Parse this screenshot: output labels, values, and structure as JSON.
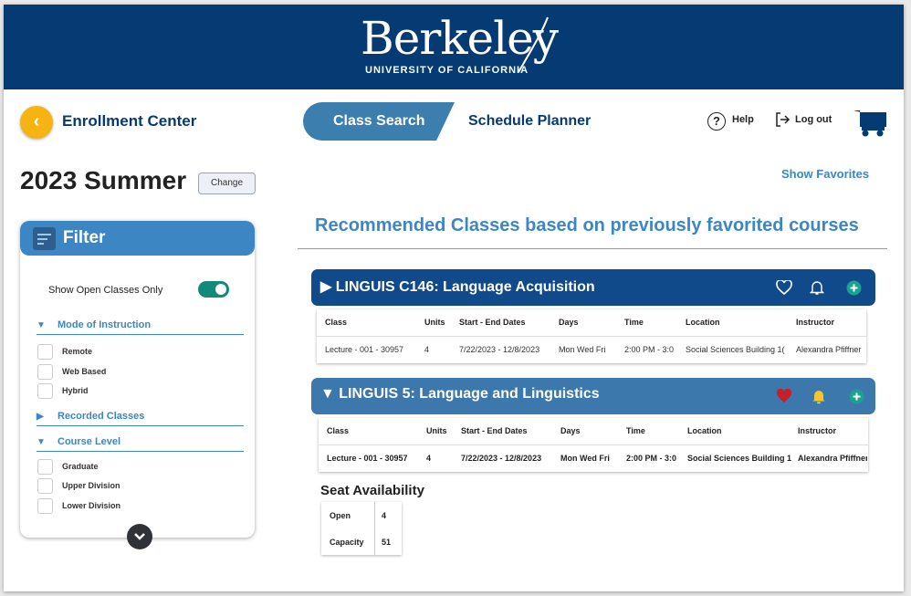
{
  "colors": {
    "navy": "#053a73",
    "accent_blue": "#3c86c4",
    "gold": "#f5b413",
    "teal": "#128a7b",
    "heart_red": "#c41f2b"
  },
  "brand": {
    "logo_main": "Berkeley",
    "logo_sub": "UNIVERSITY OF CALIFORNIA"
  },
  "header": {
    "back_icon": "chevron-left-icon",
    "app_title": "Enrollment Center",
    "tabs": [
      {
        "label": "Class Search",
        "active": true
      },
      {
        "label": "Schedule Planner",
        "active": false
      }
    ],
    "help_label": "Help",
    "logout_label": "Log out",
    "cart_icon": "cart-icon"
  },
  "term": {
    "label": "2023 Summer",
    "change_label": "Change"
  },
  "favorites": {
    "label": "Show Favorites"
  },
  "filter": {
    "title": "Filter",
    "open_only_label": "Show Open Classes Only",
    "open_only_on": true,
    "sections": [
      {
        "label": "Mode of Instruction",
        "expanded": true,
        "options": [
          "Remote",
          "Web Based",
          "Hybrid"
        ]
      },
      {
        "label": "Recorded Classes",
        "expanded": false,
        "options": []
      },
      {
        "label": "Course Level",
        "expanded": true,
        "options": [
          "Graduate",
          "Upper Division",
          "Lower Division"
        ]
      }
    ]
  },
  "recommended_title": "Recommended Classes based on previously favorited courses",
  "columns": [
    "Class",
    "Units",
    "Start - End Dates",
    "Days",
    "Time",
    "Location",
    "Instructor"
  ],
  "courses": [
    {
      "title": "LINGUIS C146: Language Acquisition",
      "expanded": false,
      "favorited": false,
      "row": [
        "Lecture - 001 - 30957",
        "4",
        "7/22/2023 - 12/8/2023",
        "Mon Wed Fri",
        "2:00 PM - 3:0",
        "Social Sciences Building 1(",
        "Alexandra Pfiffner"
      ]
    },
    {
      "title": "LINGUIS 5: Language and Linguistics",
      "expanded": true,
      "favorited": true,
      "row": [
        "Lecture - 001 - 30957",
        "4",
        "7/22/2023 - 12/8/2023",
        "Mon Wed Fri",
        "2:00 PM - 3:0",
        "Social Sciences Building 1",
        "Alexandra Pfiffner"
      ]
    }
  ],
  "seat": {
    "title": "Seat Availability",
    "rows": [
      {
        "label": "Open",
        "value": "4"
      },
      {
        "label": "Capacity",
        "value": "51"
      }
    ]
  }
}
